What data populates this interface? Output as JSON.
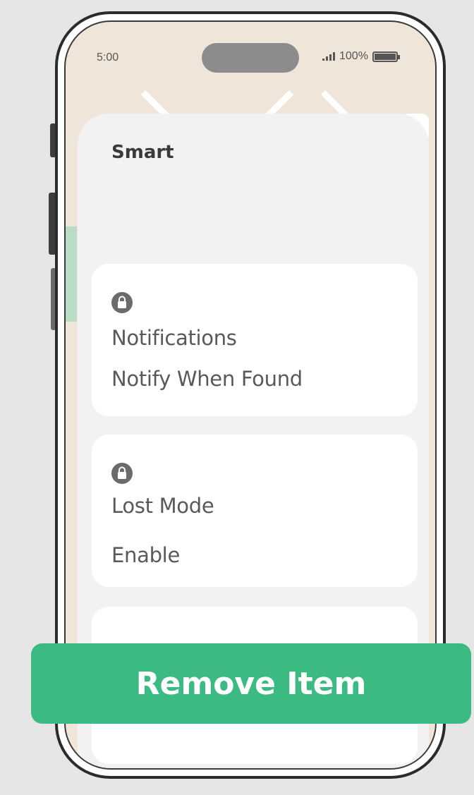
{
  "status_bar": {
    "time": "5:00",
    "battery": "100%"
  },
  "sheet": {
    "title": "Smart"
  },
  "cards": [
    {
      "icon": "lock-icon",
      "title": "Notifications",
      "value": "Notify When Found"
    },
    {
      "icon": "lock-icon",
      "title": "Lost Mode",
      "value": "Enable"
    }
  ],
  "actions": {
    "remove_label": "Remove Item"
  },
  "colors": {
    "accent": "#3bbb81",
    "map_background": "#efe6d9",
    "sheet_background": "#f2f2f2"
  }
}
